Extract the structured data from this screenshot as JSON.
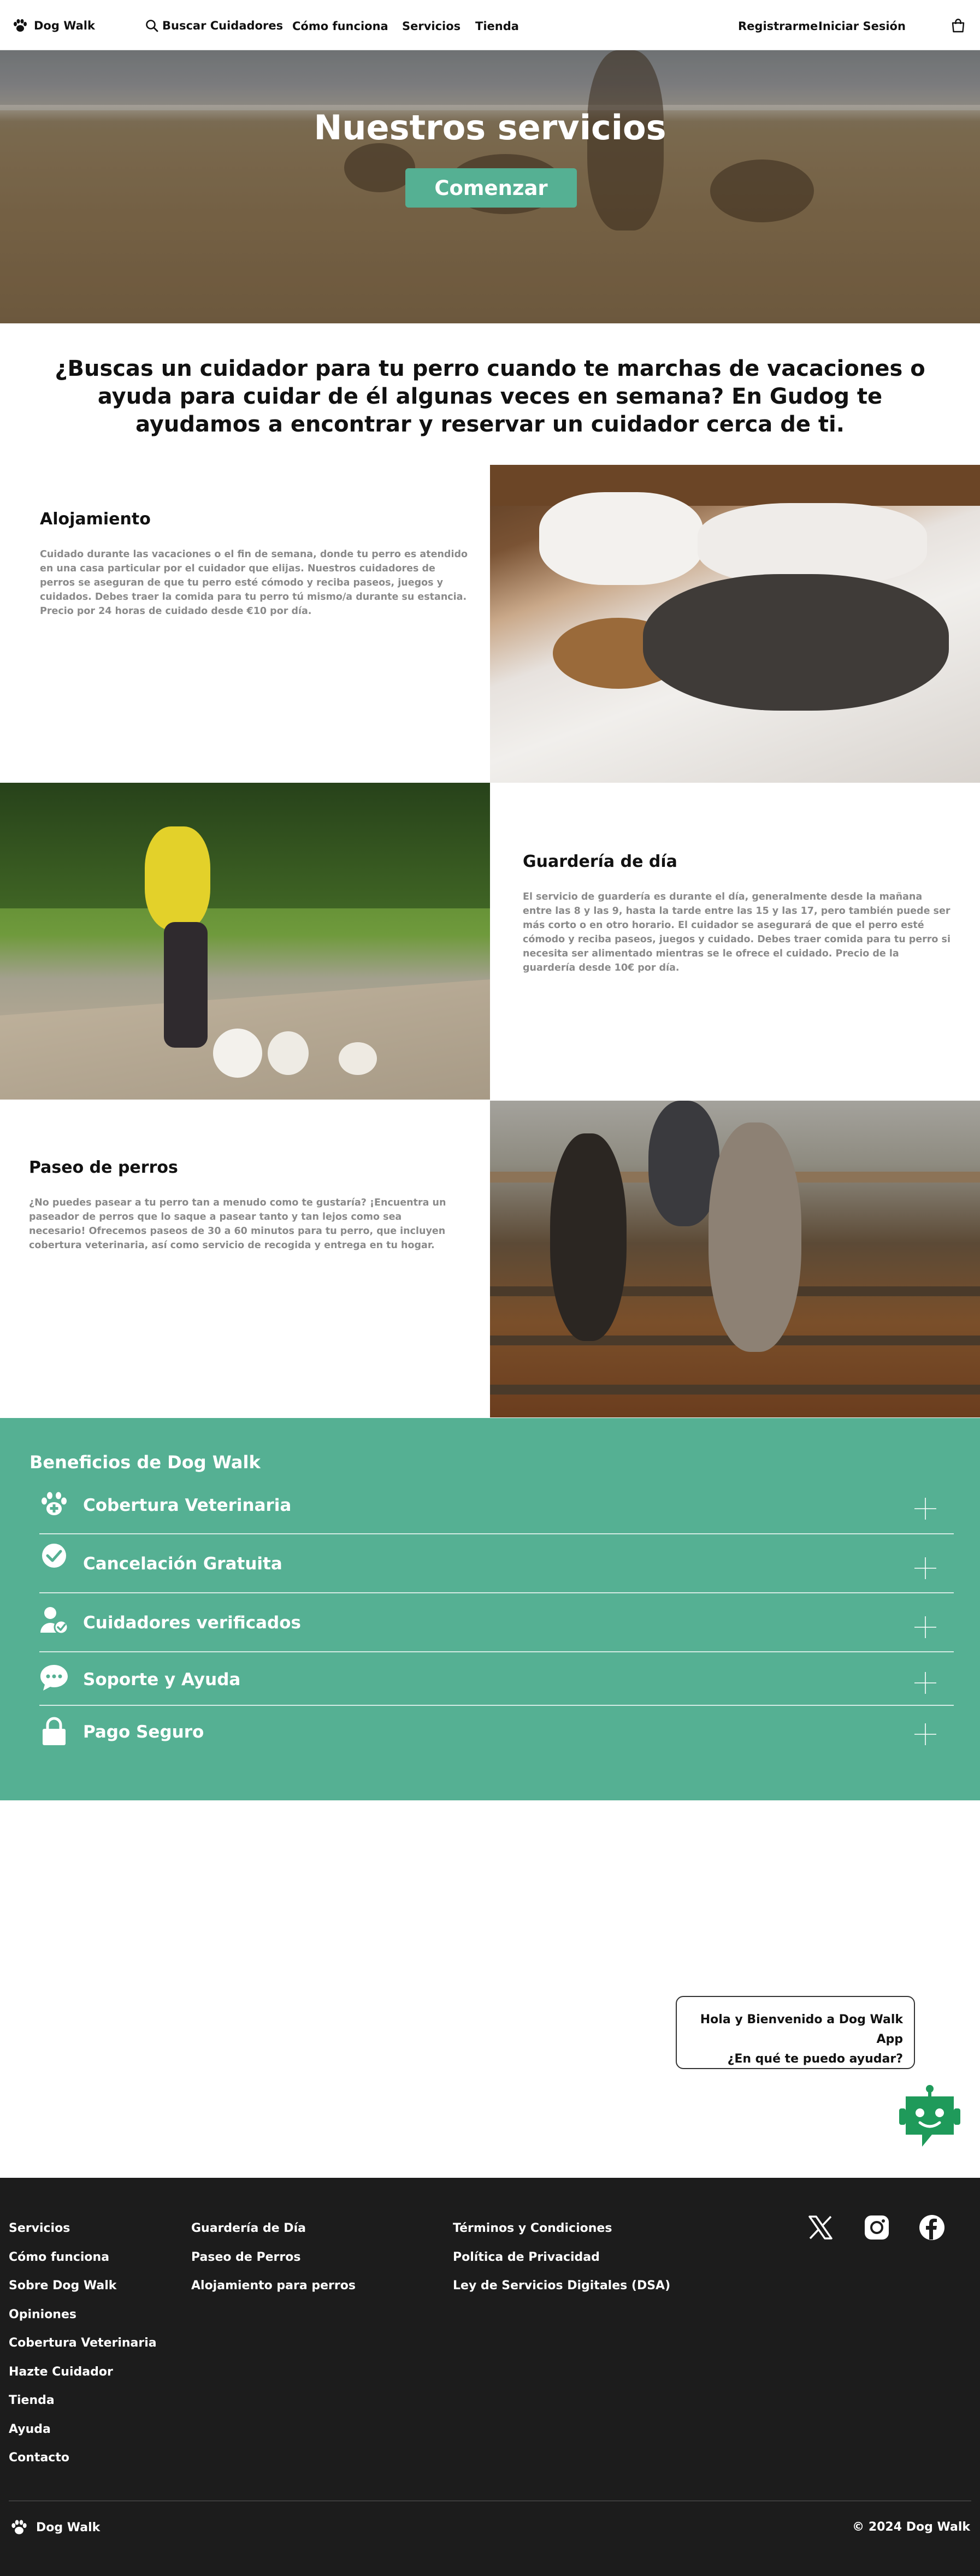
{
  "nav": {
    "brand": "Dog Walk",
    "search": "Buscar Cuidadores",
    "how": "Cómo funciona",
    "services": "Servicios",
    "store": "Tienda",
    "register": "Registrarme",
    "login": "Iniciar Sesión"
  },
  "hero": {
    "title": "Nuestros servicios",
    "cta": "Comenzar"
  },
  "intro": "¿Buscas un cuidador para tu perro cuando te marchas de vacaciones o ayuda para cuidar de él algunas veces en semana? En Gudog te ayudamos a encontrar y reservar un cuidador cerca de ti.",
  "services": [
    {
      "title": "Alojamiento",
      "text": "Cuidado durante las vacaciones o el fin de semana, donde tu perro es atendido en una casa particular por el cuidador que elijas. Nuestros cuidadores de perros se aseguran de que tu perro esté cómodo y reciba paseos, juegos y cuidados. Debes traer la comida para tu perro tú mismo/a durante su estancia. Precio por 24 horas de cuidado desde €10 por día."
    },
    {
      "title": "Guardería de día",
      "text": "El servicio de guardería es durante el día, generalmente desde la mañana entre las 8 y las 9, hasta la tarde entre las 15 y las 17, pero también puede ser más corto o en otro horario. El cuidador se asegurará de que el perro esté cómodo y reciba paseos, juegos y cuidado. Debes traer comida para tu perro si necesita ser alimentado mientras se le ofrece el cuidado. Precio de la guardería desde 10€ por día."
    },
    {
      "title": "Paseo de perros",
      "text": "¿No puedes pasear a tu perro tan a menudo como te gustaría? ¡Encuentra un paseador de perros que lo saque a pasear tanto y tan lejos como sea necesario! Ofrecemos paseos de 30 a 60 minutos para tu perro, que incluyen cobertura veterinaria, así como servicio de recogida y entrega en tu hogar."
    }
  ],
  "benefits": {
    "title": "Beneficios de Dog Walk",
    "items": [
      {
        "label": "Cobertura Veterinaria",
        "icon": "paw-plus-icon"
      },
      {
        "label": "Cancelación Gratuita",
        "icon": "check-circle-icon"
      },
      {
        "label": "Cuidadores verificados",
        "icon": "user-check-icon"
      },
      {
        "label": "Soporte y Ayuda",
        "icon": "chat-bubble-icon"
      },
      {
        "label": "Pago Seguro",
        "icon": "lock-icon"
      }
    ]
  },
  "chat": {
    "line1": "Hola y Bienvenido a Dog Walk App",
    "line2": "¿En qué te puedo ayudar?"
  },
  "footer": {
    "col1": [
      "Servicios",
      "Cómo funciona",
      "Sobre Dog Walk",
      "Opiniones",
      "Cobertura Veterinaria",
      "Hazte Cuidador",
      "Tienda",
      "Ayuda",
      "Contacto"
    ],
    "col2": [
      "Guardería de Día",
      "Paseo de Perros",
      "Alojamiento para perros"
    ],
    "col3": [
      "Términos y Condiciones",
      "Política de Privacidad",
      "Ley de Servicios Digitales (DSA)"
    ],
    "brand": "Dog Walk",
    "copyright": "© 2024 Dog Walk"
  },
  "colors": {
    "accent": "#55b093",
    "footer_bg": "#1c1c1c",
    "bot_green": "#1f9a5a"
  }
}
